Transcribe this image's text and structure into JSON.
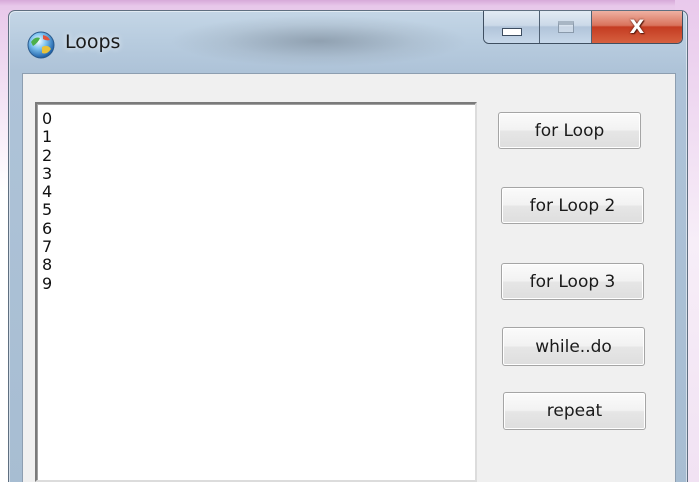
{
  "window": {
    "title": "Loops",
    "icon": "application-globe-icon"
  },
  "caption": {
    "minimize": "minimize-icon",
    "maximize": "maximize-icon",
    "close_label": "X"
  },
  "listbox": {
    "items": [
      "0",
      "1",
      "2",
      "3",
      "4",
      "5",
      "6",
      "7",
      "8",
      "9"
    ]
  },
  "buttons": {
    "for_loop": "for Loop",
    "for_loop_2": "for Loop 2",
    "for_loop_3": "for Loop 3",
    "while_do": "while..do",
    "repeat": "repeat"
  },
  "colors": {
    "close_button": "#c43c22",
    "titlebar": "#b8ccdf"
  }
}
